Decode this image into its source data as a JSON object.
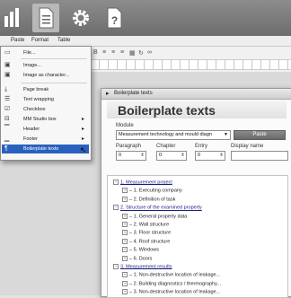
{
  "top_icons": [
    "chart-icon",
    "document-icon",
    "gear-icon",
    "help-icon"
  ],
  "menubar": {
    "items": [
      "Paste",
      "Format",
      "Table"
    ]
  },
  "insert_menu": {
    "items": [
      {
        "label": "File...",
        "icon": "file-icon"
      },
      {
        "label": "Image...",
        "icon": "image-icon"
      },
      {
        "label": "Image as character...",
        "icon": "image-character-icon"
      },
      {
        "label": "Page break",
        "icon": "page-break-icon"
      },
      {
        "label": "Text wrapping",
        "icon": "text-wrap-icon"
      },
      {
        "label": "Checkbox",
        "icon": "checkbox-icon"
      },
      {
        "label": "MM Studio box",
        "icon": "studio-box-icon",
        "submenu": true
      },
      {
        "label": "Header",
        "icon": "header-icon",
        "submenu": true
      },
      {
        "label": "Footer",
        "icon": "footer-icon",
        "submenu": true
      },
      {
        "label": "Boilerplate texts",
        "icon": "boilerplate-icon",
        "selected": true
      }
    ]
  },
  "dialog": {
    "window_title": "Boilerplate texts",
    "heading": "Boilerplate texts",
    "module_label": "Module",
    "module_value": "Measurement technology and mould diagn",
    "paste_button": "Paste",
    "paragraph_label": "Paragraph",
    "paragraph_value": "0",
    "chapter_label": "Chapter",
    "chapter_value": "0",
    "entry_label": "Entry",
    "entry_value": "0",
    "display_name_label": "Display name"
  },
  "tree": [
    {
      "text": "1. Measurement project",
      "level": 0,
      "head": true
    },
    {
      "text": "1. Executing company",
      "level": 1
    },
    {
      "text": "2. Definition of task",
      "level": 1
    },
    {
      "text": "2. Structure of the examined property",
      "level": 0,
      "head": true
    },
    {
      "text": "1. General property data",
      "level": 1
    },
    {
      "text": "2. Wall structure",
      "level": 1
    },
    {
      "text": "3. Floor structure",
      "level": 1
    },
    {
      "text": "4. Roof structure",
      "level": 1
    },
    {
      "text": "5. Windows",
      "level": 1
    },
    {
      "text": "6. Doors",
      "level": 1
    },
    {
      "text": "3. Measurement results",
      "level": 0,
      "head": true
    },
    {
      "text": "1. Non-destructive location of leakage...",
      "level": 1
    },
    {
      "text": "2. Building diagnostics / thermography...",
      "level": 1
    },
    {
      "text": "3. Non-destructive location of leakage...",
      "level": 1
    }
  ]
}
